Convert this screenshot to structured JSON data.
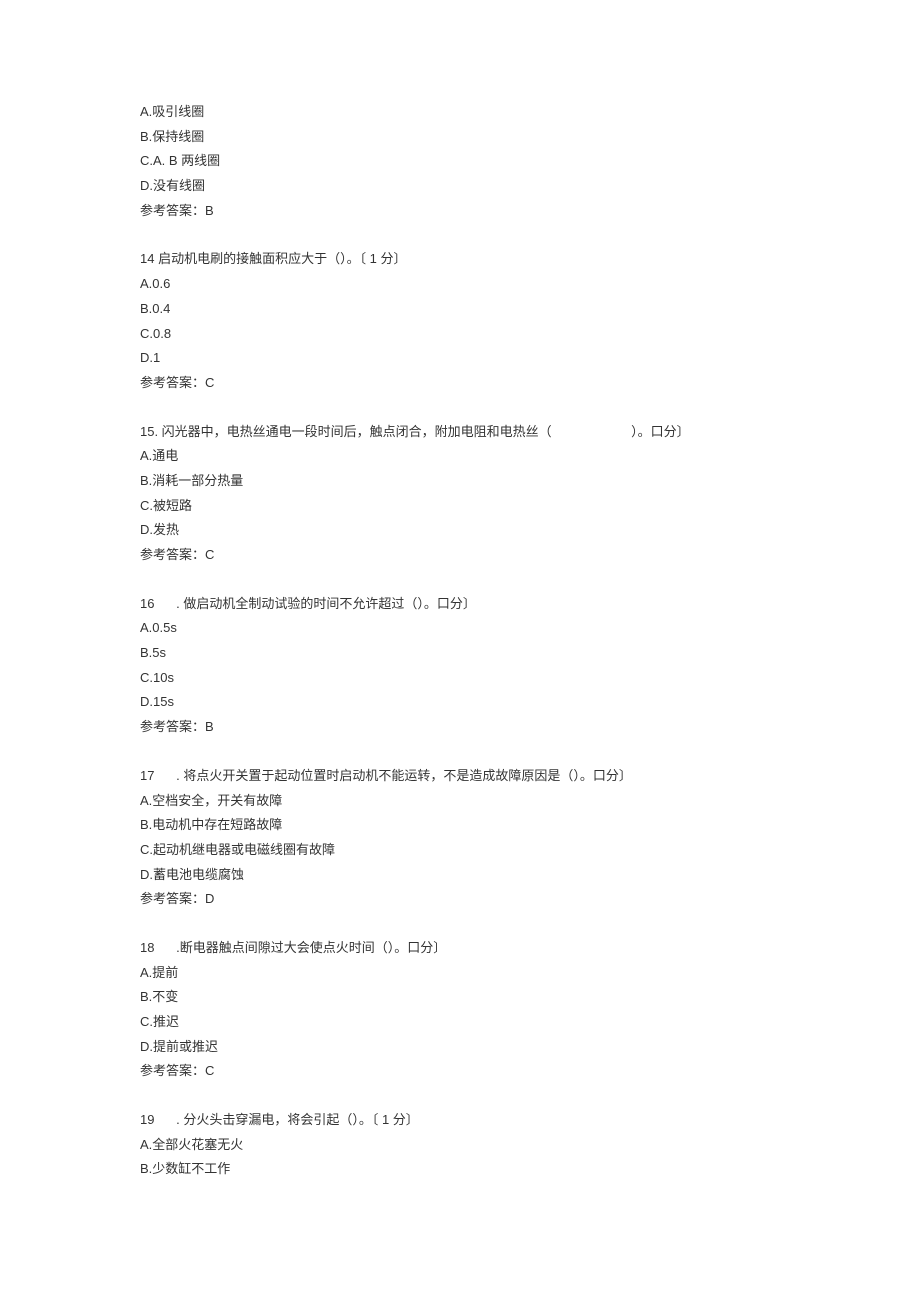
{
  "blocks": [
    {
      "question": "",
      "options": [
        "A.吸引线圈",
        "B.保持线圈",
        "C.A. B 两线圈",
        "D.没有线圈"
      ],
      "answer": "参考答案：B"
    },
    {
      "question": "14 启动机电刷的接触面积应大于（）。〔 1 分〕",
      "options": [
        "A.0.6",
        "B.0.4",
        "C.0.8",
        "D.1"
      ],
      "answer": "参考答案：C"
    },
    {
      "question": "15. 闪光器中，电热丝通电一段时间后，触点闭合，附加电阻和电热丝（                      ）。口分〕",
      "options": [
        "A.通电",
        "B.消耗一部分热量",
        "C.被短路",
        "D.发热"
      ],
      "answer": "参考答案：C"
    },
    {
      "question": "16      . 做启动机全制动试验的时间不允许超过（）。口分〕",
      "options": [
        "A.0.5s",
        "B.5s",
        "C.10s",
        "D.15s"
      ],
      "answer": "参考答案：B"
    },
    {
      "question": "17      . 将点火开关置于起动位置时启动机不能运转，不是造成故障原因是（）。口分〕",
      "options": [
        "A.空档安全，开关有故障",
        "B.电动机中存在短路故障",
        "C.起动机继电器或电磁线圈有故障",
        "D.蓄电池电缆腐蚀"
      ],
      "answer": "参考答案：D"
    },
    {
      "question": "18      .断电器触点间隙过大会使点火时间（）。口分〕",
      "options": [
        "A.提前",
        "B.不变",
        "C.推迟",
        "D.提前或推迟"
      ],
      "answer": "参考答案：C"
    },
    {
      "question": "19      . 分火头击穿漏电，将会引起（）。〔 1 分〕",
      "options": [
        "A.全部火花塞无火",
        "B.少数缸不工作"
      ],
      "answer": ""
    }
  ]
}
